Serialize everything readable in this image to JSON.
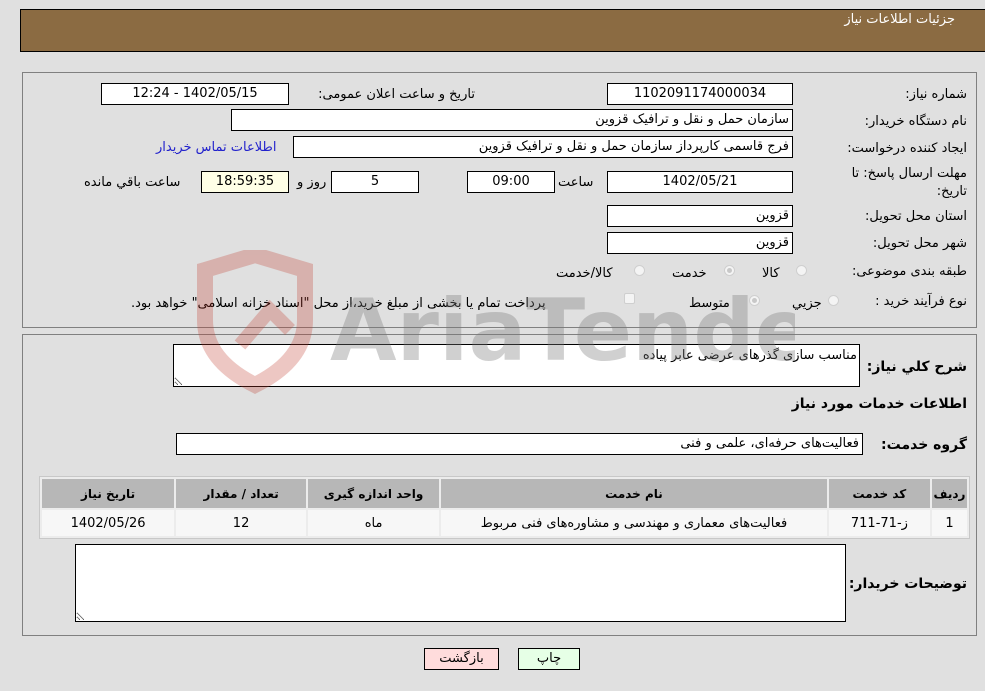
{
  "header": {
    "title": "جزئیات اطلاعات نیاز"
  },
  "fields": {
    "need_number": {
      "label": "شماره نیاز:",
      "value": "1102091174000034"
    },
    "announce_datetime": {
      "label": "تاریخ و ساعت اعلان عمومی:",
      "value": "1402/05/15 - 12:24"
    },
    "buyer_org": {
      "label": "نام دستگاه خریدار:",
      "value": "سازمان حمل و نقل و ترافیک قزوین"
    },
    "requester": {
      "label": "ایجاد کننده درخواست:",
      "value": "فرج قاسمی کارپرداز سازمان حمل و نقل و ترافیک قزوین"
    },
    "buyer_contact_link": "اطلاعات تماس خریدار",
    "deadline": {
      "label": "مهلت ارسال پاسخ: تا تاریخ:",
      "date": "1402/05/21",
      "time_label": "ساعت",
      "time": "09:00",
      "days": "5",
      "days_label": "روز و",
      "remaining": "18:59:35",
      "remaining_label": "ساعت باقي مانده"
    },
    "province": {
      "label": "استان محل تحویل:",
      "value": "قزوین"
    },
    "city": {
      "label": "شهر محل تحویل:",
      "value": "قزوین"
    },
    "category": {
      "label": "طبقه بندی موضوعی:",
      "options": [
        "کالا",
        "خدمت",
        "کالا/خدمت"
      ],
      "selected": "خدمت"
    },
    "purchase_type": {
      "label": "نوع فرآیند خرید :",
      "options": [
        "جزیي",
        "متوسط"
      ],
      "selected": "متوسط",
      "treasury_note": "پرداخت تمام یا بخشی از مبلغ خرید،از محل \"اسناد خزانه اسلامی\" خواهد بود."
    }
  },
  "description": {
    "label": "شرح کلي نیاز:",
    "value": "مناسب سازی گذرهای عرضی عابر پیاده"
  },
  "services_section_title": "اطلاعات خدمات مورد نیاز",
  "service_group": {
    "label": "گروه خدمت:",
    "value": "فعالیت‌های حرفه‌ای، علمی و فنی"
  },
  "table": {
    "headers": [
      "ردیف",
      "کد خدمت",
      "نام خدمت",
      "واحد اندازه گیری",
      "تعداد / مقدار",
      "تاریخ نیاز"
    ],
    "rows": [
      [
        "1",
        "ز-71-711",
        "فعالیت‌های معماری و مهندسی و مشاوره‌های فنی مربوط",
        "ماه",
        "12",
        "1402/05/26"
      ]
    ]
  },
  "buyer_notes": {
    "label": "توضیحات خریدار:",
    "value": ""
  },
  "buttons": {
    "print": "چاپ",
    "back": "بازگشت"
  },
  "watermark": {
    "text": "AriaTender.neT"
  }
}
